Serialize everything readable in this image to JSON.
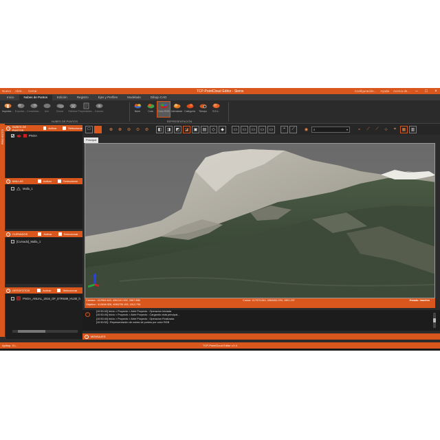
{
  "titlebar": {
    "quick_access": [
      "Nuevo",
      "Abrir...",
      "Cerrar"
    ],
    "title": "TCP-PointCloud Editor - Sierra",
    "right": [
      "Configuración...",
      "Ayuda",
      "Acerca de..."
    ]
  },
  "tabs": [
    "Inicio",
    "Nubes de Puntos",
    "Edición",
    "Registro",
    "Ejes y Perfiles",
    "Modelado",
    "Dibujo CAD"
  ],
  "active_tab": "Nubes de Puntos",
  "ribbon": {
    "group1_buttons": [
      "Importar...",
      "Exportar...",
      "Consolidar...",
      "Unir",
      "Clonar",
      "Eliminar",
      "Propiedades...",
      "Colores"
    ],
    "group1_label": "NUBES DE PUNTOS",
    "group2_buttons": [
      "Nube",
      "Cota",
      "Color RGB",
      "Intensidad",
      "Categoría",
      "Tiempo",
      "S.D.L."
    ],
    "group2_label": "REPRESENTACIÓN"
  },
  "left_strip_label": "PROYECTO",
  "panels": {
    "nubes": {
      "title": "NUBES DE PUNTOS",
      "activar": "Activar",
      "seleccionar": "Seleccionar",
      "items": [
        "PNOA"
      ]
    },
    "mallas": {
      "title": "MALLAS",
      "activar": "Activar",
      "seleccionar": "Seleccionar",
      "items": [
        "Malla_1"
      ]
    },
    "curvados": {
      "title": "CURVADOS",
      "activar": "Activar",
      "seleccionar": "Seleccionar",
      "items": [
        "[Curvado]_Malla_1"
      ]
    },
    "ortofotos": {
      "title": "ORTOFOTOS",
      "activar": "Activar",
      "seleccionar": "Seleccionar",
      "items": [
        "PNOA_ANUAL_2016_OF_ETRS89_HU30_h"
      ]
    }
  },
  "viewer": {
    "tab_label": "Principal",
    "dropdown_value": "0",
    "camera": "Cámara : 412964.643, 4061141.992, 2667.858",
    "objective": "Objetivo : 413466.526, 4060709.153, 1612.736",
    "cursor": "Cursor: 417573.840, 4063452.293, 1901.297",
    "state": "Estado: Inactivo"
  },
  "log": {
    "lines": [
      "[10:50:40] Inicio > Proyecto > Abrir Proyecto : Operacion Iniciada",
      "[10:50:40] Inicio > Proyecto > Abrir Proyecto : Cargando vista principal...",
      "[10:50:40] Inicio > Proyecto > Abrir Proyecto : Operacion Finalizada",
      "[10:50:52] : Representación de nubes de puntos por color RGB"
    ]
  },
  "messages_label": "MENSAJES",
  "footer": {
    "company": "Aplitop, S.L.",
    "app": "TCP-PointCloud Editor v.0.4"
  },
  "colors": {
    "accent": "#d9561c",
    "panel": "#1e1e1e",
    "chrome": "#2b2b2b"
  }
}
